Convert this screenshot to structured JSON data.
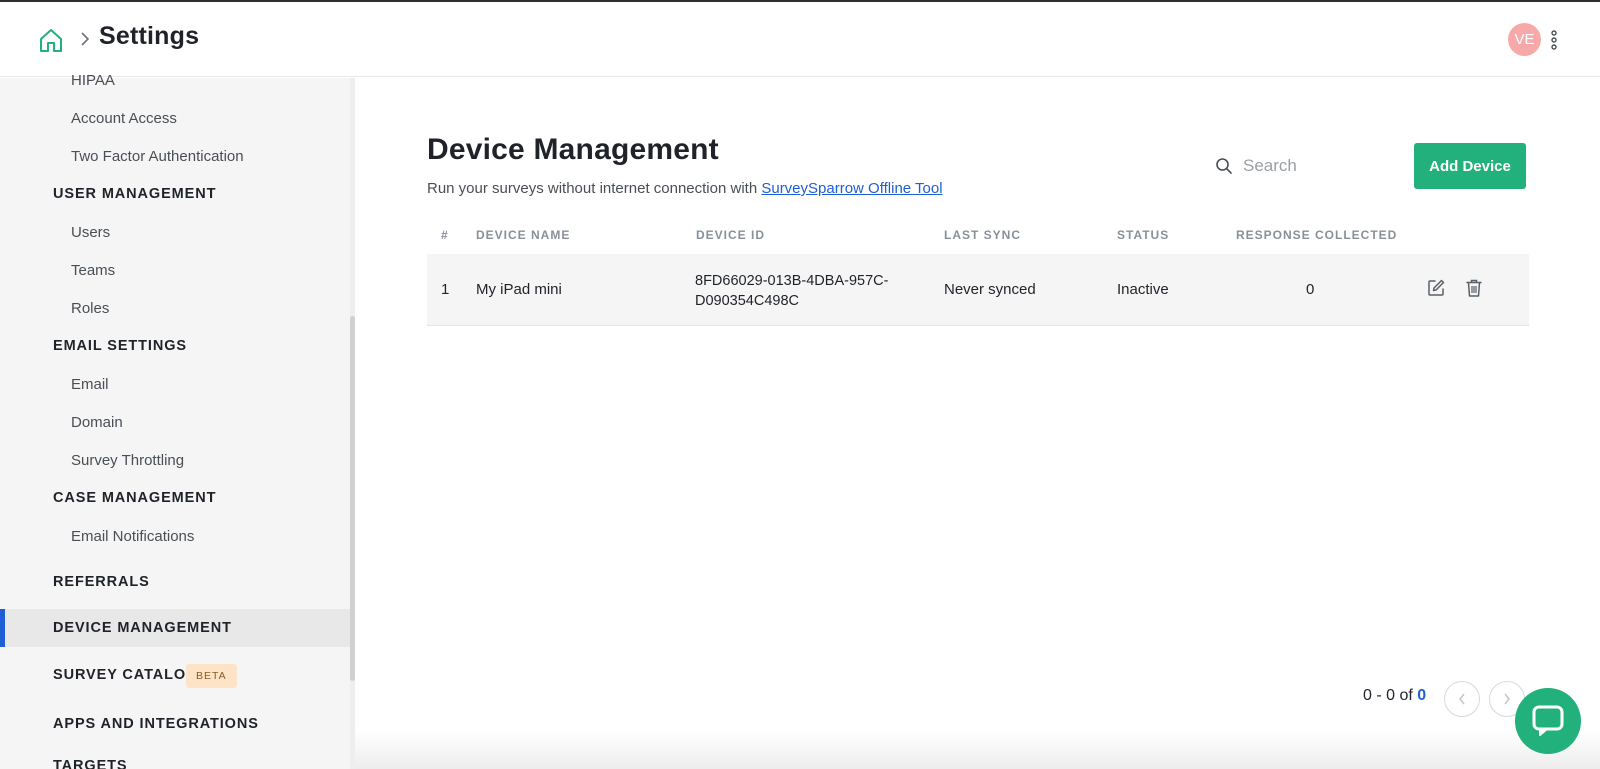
{
  "header": {
    "title": "Settings",
    "avatar_initials": "VE"
  },
  "sidebar": {
    "items": [
      {
        "label": "HIPAA"
      },
      {
        "label": "Account Access"
      },
      {
        "label": "Two Factor Authentication"
      }
    ],
    "user_management": {
      "section": "USER MANAGEMENT",
      "items": [
        "Users",
        "Teams",
        "Roles"
      ]
    },
    "email_settings": {
      "section": "EMAIL SETTINGS",
      "items": [
        "Email",
        "Domain",
        "Survey Throttling"
      ]
    },
    "case_management": {
      "section": "CASE MANAGEMENT",
      "items": [
        "Email Notifications"
      ]
    },
    "top_level": {
      "referrals": "REFERRALS",
      "device_management": "DEVICE MANAGEMENT",
      "survey_catalog": "SURVEY CATALOG",
      "survey_catalog_badge": "BETA",
      "apps_and_integrations": "APPS AND INTEGRATIONS",
      "targets": "TARGETS"
    },
    "active_item": "DEVICE MANAGEMENT"
  },
  "main": {
    "title": "Device Management",
    "subtitle_prefix": "Run your surveys without internet connection with ",
    "subtitle_link": "SurveySparrow Offline Tool",
    "search_placeholder": "Search",
    "add_button": "Add Device",
    "table": {
      "columns": [
        "#",
        "DEVICE NAME",
        "DEVICE ID",
        "LAST SYNC",
        "STATUS",
        "RESPONSE COLLECTED"
      ],
      "rows": [
        {
          "index": "1",
          "device_name": "My iPad mini",
          "device_id_line1": "8FD66029-013B-4DBA-957C-",
          "device_id_line2": "D090354C498C",
          "last_sync": "Never synced",
          "status": "Inactive",
          "response_collected": "0"
        }
      ]
    },
    "pagination": {
      "range": "0 - 0",
      "of": "of",
      "total": "0"
    }
  },
  "colors": {
    "accent_green": "#22b07d",
    "active_bar": "#1f5fd6",
    "link": "#1f5fd6",
    "avatar_bg": "#f7a8a8",
    "beta_bg": "#fde4c6"
  },
  "icons": {
    "home": "home-icon",
    "breadcrumb": "chevron-right-icon",
    "menu": "kebab-menu-icon",
    "search": "search-icon",
    "edit": "edit-icon",
    "delete": "trash-icon",
    "prev": "chevron-left-icon",
    "next": "chevron-right-icon",
    "chat": "chat-icon"
  }
}
